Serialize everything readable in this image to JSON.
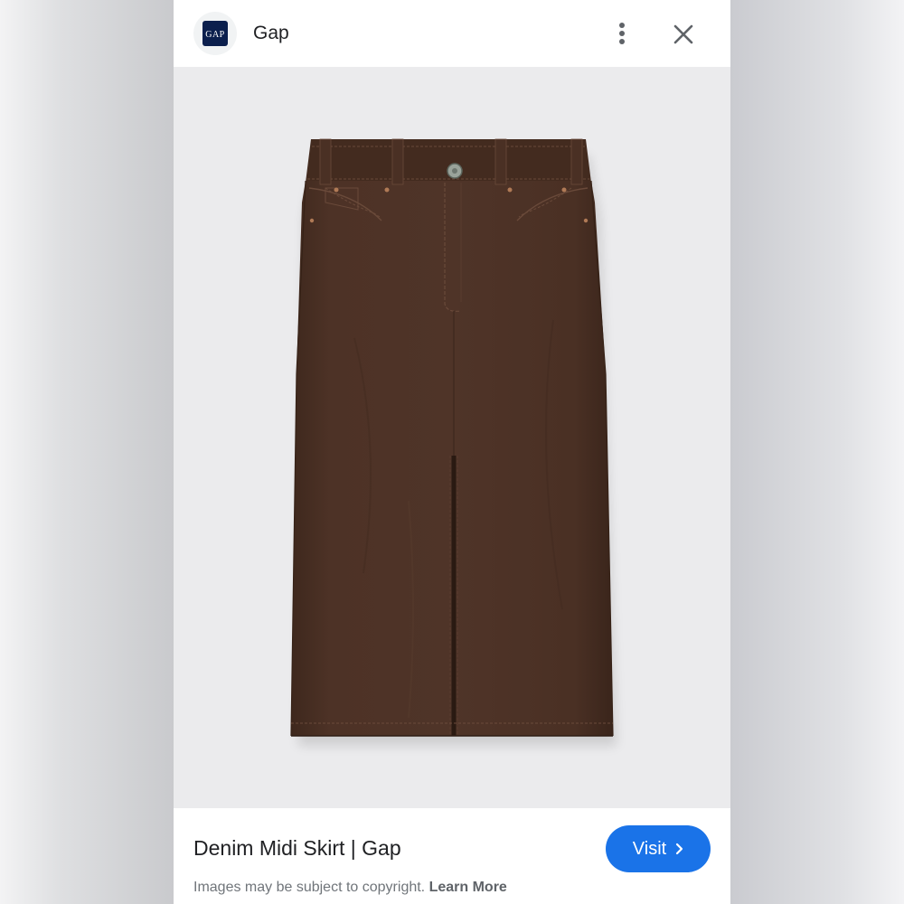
{
  "header": {
    "site_name": "Gap",
    "logo_text": "GAP",
    "more_icon": "more-vert-icon",
    "close_icon": "close-icon"
  },
  "image": {
    "subject": "product-image",
    "background_color": "#ebebed",
    "product_color": "#4a3024"
  },
  "footer": {
    "title": "Denim Midi Skirt | Gap",
    "visit_label": "Visit",
    "visit_icon": "chevron-right-icon",
    "copyright_text": "Images may be subject to copyright.",
    "learn_more_label": "Learn More"
  },
  "colors": {
    "accent": "#1a73e8",
    "logo_bg": "#0b1f4d"
  }
}
